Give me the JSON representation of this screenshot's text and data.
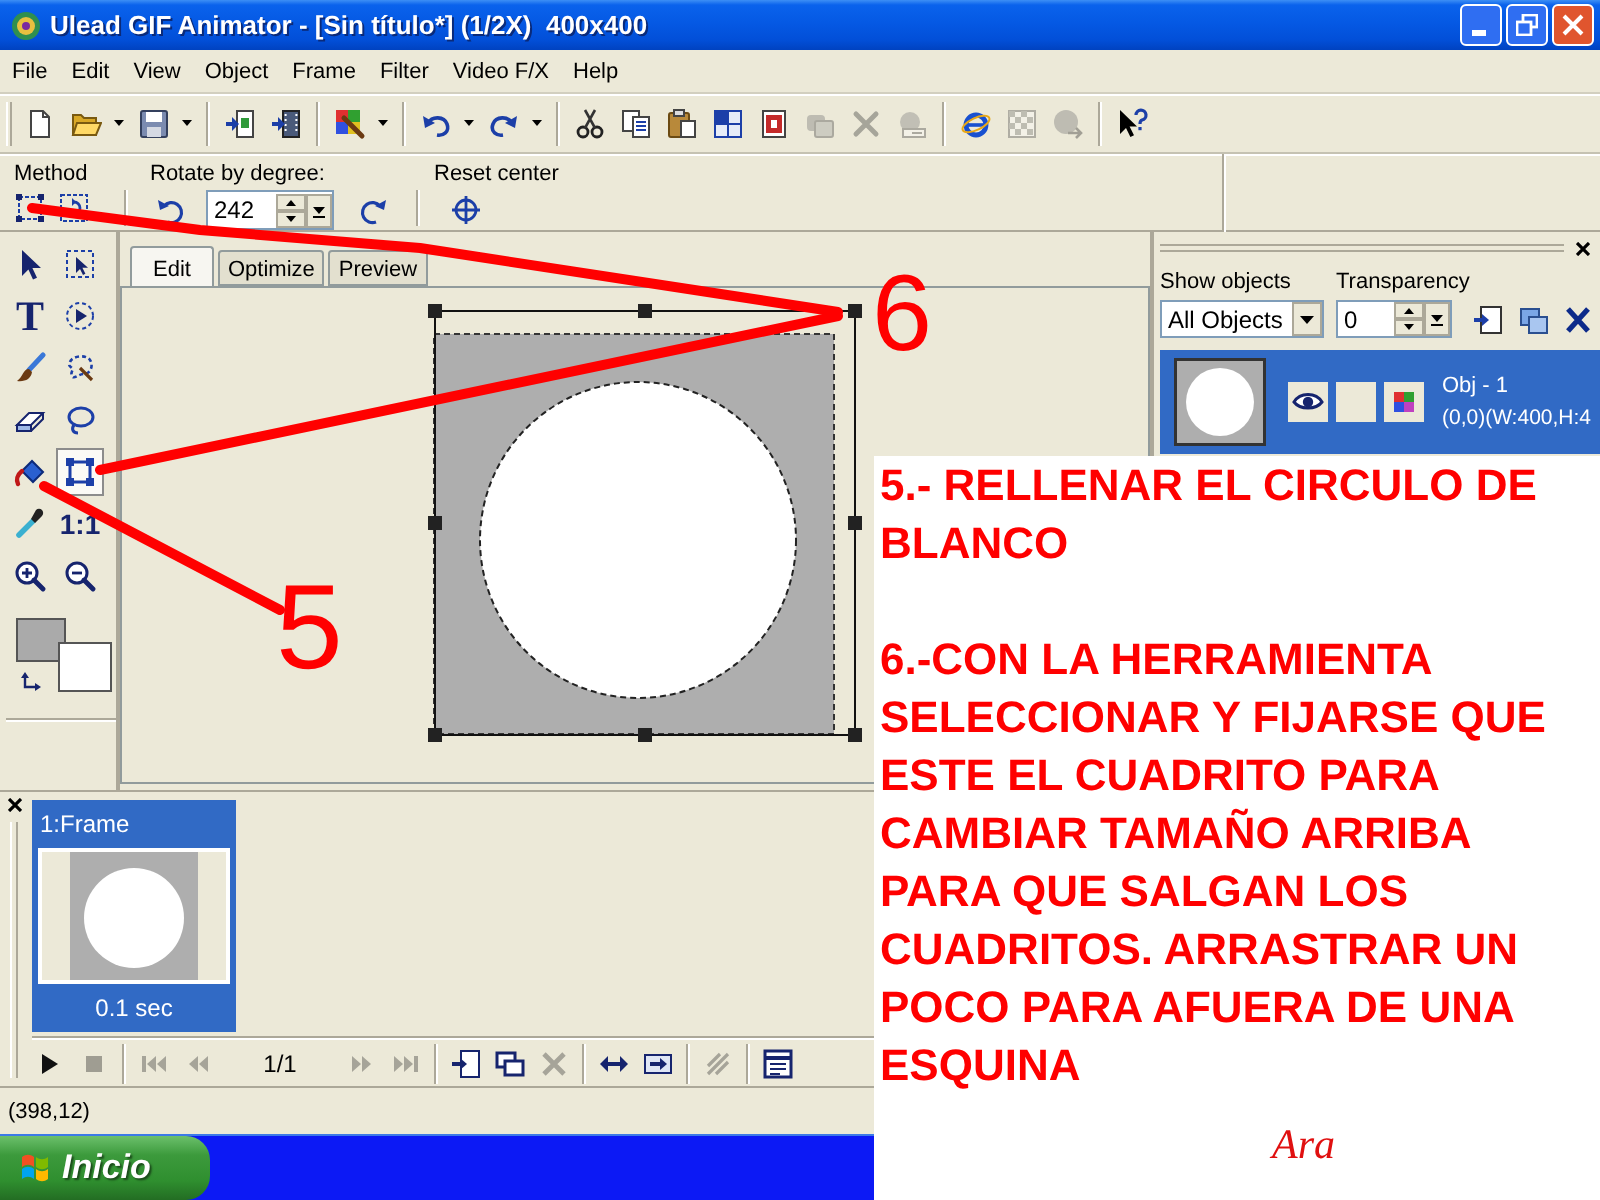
{
  "window": {
    "title": "Ulead GIF Animator - [Sin título*] (1/2X)  400x400"
  },
  "menu": [
    "File",
    "Edit",
    "View",
    "Object",
    "Frame",
    "Filter",
    "Video F/X",
    "Help"
  ],
  "toolbar": [
    [
      {
        "kind": "new",
        "dropdown": false,
        "disabled": false
      },
      {
        "kind": "open",
        "dropdown": true,
        "disabled": false
      },
      {
        "kind": "save",
        "dropdown": true,
        "disabled": false
      }
    ],
    [
      {
        "kind": "add-image",
        "dropdown": false,
        "disabled": false
      },
      {
        "kind": "add-video",
        "dropdown": false,
        "disabled": false
      }
    ],
    [
      {
        "kind": "edit-external",
        "dropdown": true,
        "disabled": false
      }
    ],
    [
      {
        "kind": "undo",
        "dropdown": true,
        "disabled": false
      },
      {
        "kind": "redo",
        "dropdown": true,
        "disabled": false
      }
    ],
    [
      {
        "kind": "cut",
        "dropdown": false,
        "disabled": false
      },
      {
        "kind": "copy",
        "dropdown": false,
        "disabled": false
      },
      {
        "kind": "paste",
        "dropdown": false,
        "disabled": false
      },
      {
        "kind": "crop",
        "dropdown": false,
        "disabled": false
      },
      {
        "kind": "picture-file",
        "dropdown": false,
        "disabled": false
      },
      {
        "kind": "layers",
        "dropdown": false,
        "disabled": true
      },
      {
        "kind": "cross",
        "dropdown": false,
        "disabled": true
      },
      {
        "kind": "tray",
        "dropdown": false,
        "disabled": true
      }
    ],
    [
      {
        "kind": "browser",
        "dropdown": false,
        "disabled": false
      },
      {
        "kind": "checkered",
        "dropdown": false,
        "disabled": true
      },
      {
        "kind": "sphere",
        "dropdown": false,
        "disabled": true
      }
    ],
    [
      {
        "kind": "help",
        "dropdown": false,
        "disabled": false
      }
    ]
  ],
  "property_bar": {
    "method_label": "Method",
    "rotate_label": "Rotate by degree:",
    "rotate_value": "242",
    "reset_label": "Reset center"
  },
  "tools": [
    {
      "kind": "pointer",
      "selected": false
    },
    {
      "kind": "object-select",
      "selected": false
    },
    {
      "kind": "text",
      "label": "T",
      "selected": false
    },
    {
      "kind": "play-select",
      "selected": false
    },
    {
      "kind": "paintbrush",
      "selected": false
    },
    {
      "kind": "magic-lasso",
      "selected": false
    },
    {
      "kind": "eraser",
      "selected": false
    },
    {
      "kind": "lasso",
      "selected": false
    },
    {
      "kind": "paint-bucket",
      "selected": false
    },
    {
      "kind": "transform",
      "selected": true
    },
    {
      "kind": "eyedropper",
      "selected": false
    },
    {
      "kind": "actual-size",
      "label": "1:1",
      "selected": false
    },
    {
      "kind": "zoom-in",
      "selected": false
    },
    {
      "kind": "zoom-out",
      "selected": false
    }
  ],
  "color_swatches": [
    {
      "kind": "foreground",
      "color": "#aaaaaa"
    },
    {
      "kind": "background",
      "color": "#ffffff"
    }
  ],
  "document_tabs": [
    {
      "label": "Edit",
      "selected": true
    },
    {
      "label": "Optimize",
      "selected": false
    },
    {
      "label": "Preview",
      "selected": false
    }
  ],
  "objects_panel": {
    "show_label": "Show objects",
    "show_value": "All Objects",
    "transparency_label": "Transparency",
    "transparency_value": "0",
    "objects": [
      {
        "name": "Obj - 1",
        "info": "(0,0)(W:400,H:4",
        "selected": true,
        "visible": true
      }
    ]
  },
  "frames_panel": {
    "frames": [
      {
        "label": "1:Frame",
        "delay": "0.1 sec",
        "selected": true
      }
    ],
    "controls": [
      [
        {
          "kind": "play",
          "disabled": false
        },
        {
          "kind": "stop",
          "disabled": true
        }
      ],
      [
        {
          "kind": "first",
          "disabled": true
        },
        {
          "kind": "previous",
          "disabled": true
        },
        {
          "kind": "counter",
          "label": "1/1",
          "disabled": false
        },
        {
          "kind": "next",
          "disabled": true
        },
        {
          "kind": "last",
          "disabled": true
        }
      ],
      [
        {
          "kind": "add-frame",
          "disabled": false
        },
        {
          "kind": "duplicate-frame",
          "disabled": false
        },
        {
          "kind": "delete-frame",
          "disabled": true
        }
      ],
      [
        {
          "kind": "tween",
          "disabled": false
        },
        {
          "kind": "banner",
          "disabled": false
        }
      ],
      [
        {
          "kind": "reverse",
          "disabled": true
        }
      ],
      [
        {
          "kind": "frame-properties",
          "disabled": false
        }
      ]
    ]
  },
  "status_bar": {
    "text": "(398,12)"
  },
  "taskbar": {
    "start_label": "Inicio"
  },
  "annotation": {
    "paragraphs": [
      [
        "5.- RELLENAR EL CIRCULO DE",
        "BLANCO"
      ],
      [
        "6.-CON LA HERRAMIENTA",
        "SELECCIONAR Y FIJARSE QUE",
        "ESTE EL CUADRITO PARA",
        "CAMBIAR TAMAÑO ARRIBA",
        "PARA QUE SALGAN LOS",
        "CUADRITOS. ARRASTRAR UN",
        "POCO PARA AFUERA DE UNA",
        "ESQUINA"
      ]
    ],
    "signature": "Ara",
    "markers": [
      {
        "label": "5"
      },
      {
        "label": "6"
      }
    ]
  }
}
